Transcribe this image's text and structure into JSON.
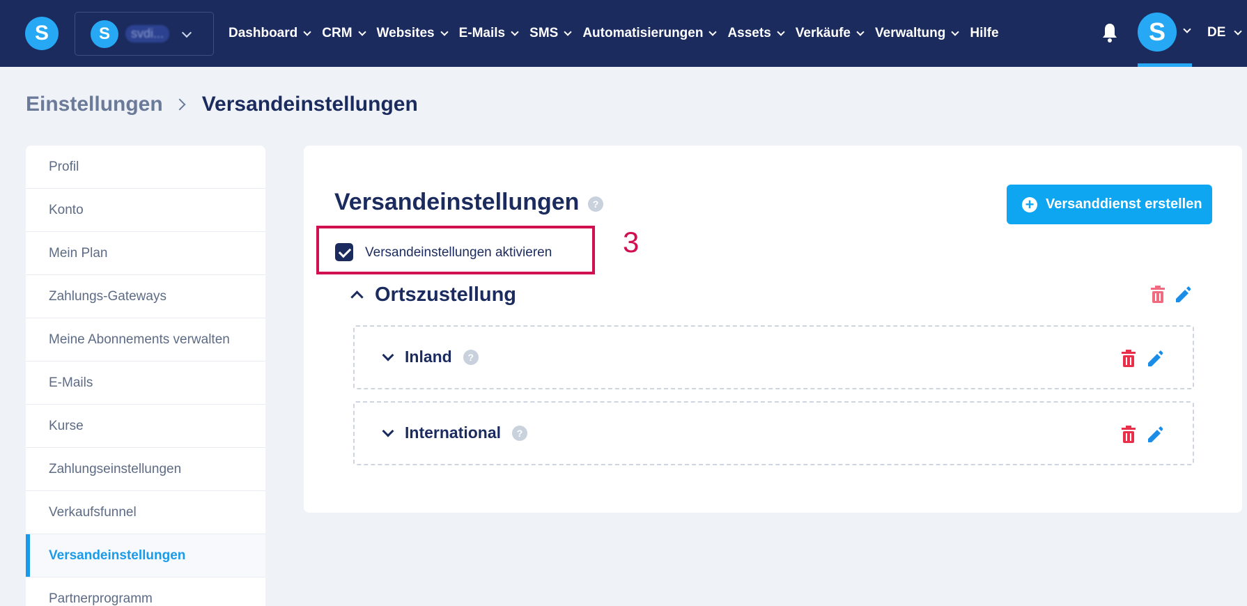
{
  "header": {
    "logo_letter": "S",
    "account_name": "svdi...",
    "nav": [
      {
        "label": "Dashboard"
      },
      {
        "label": "CRM"
      },
      {
        "label": "Websites"
      },
      {
        "label": "E-Mails"
      },
      {
        "label": "SMS"
      },
      {
        "label": "Automatisierungen"
      },
      {
        "label": "Assets"
      },
      {
        "label": "Verkäufe"
      },
      {
        "label": "Verwaltung"
      },
      {
        "label": "Hilfe"
      }
    ],
    "avatar_letter": "S",
    "language": "DE"
  },
  "breadcrumb": {
    "parent": "Einstellungen",
    "current": "Versandeinstellungen"
  },
  "sidebar": {
    "items": [
      {
        "label": "Profil"
      },
      {
        "label": "Konto"
      },
      {
        "label": "Mein Plan"
      },
      {
        "label": "Zahlungs-Gateways"
      },
      {
        "label": "Meine Abonnements verwalten"
      },
      {
        "label": "E-Mails"
      },
      {
        "label": "Kurse"
      },
      {
        "label": "Zahlungseinstellungen"
      },
      {
        "label": "Verkaufsfunnel"
      },
      {
        "label": "Versandeinstellungen"
      },
      {
        "label": "Partnerprogramm"
      }
    ],
    "active_index": 9
  },
  "main": {
    "title": "Versandeinstellungen",
    "help_glyph": "?",
    "create_button_label": "Versanddienst erstellen",
    "create_button_icon": "+",
    "enable_checkbox": {
      "label": "Versandeinstellungen aktivieren",
      "checked": true
    },
    "annotation_number": "3",
    "section": {
      "title": "Ortszustellung",
      "zones": [
        {
          "title": "Inland"
        },
        {
          "title": "International"
        }
      ]
    }
  },
  "colors": {
    "nav_bg": "#1b2b5e",
    "accent": "#0ea5f1",
    "highlight": "#d0104f",
    "delete": "#e8304a",
    "edit": "#1a8de8"
  }
}
